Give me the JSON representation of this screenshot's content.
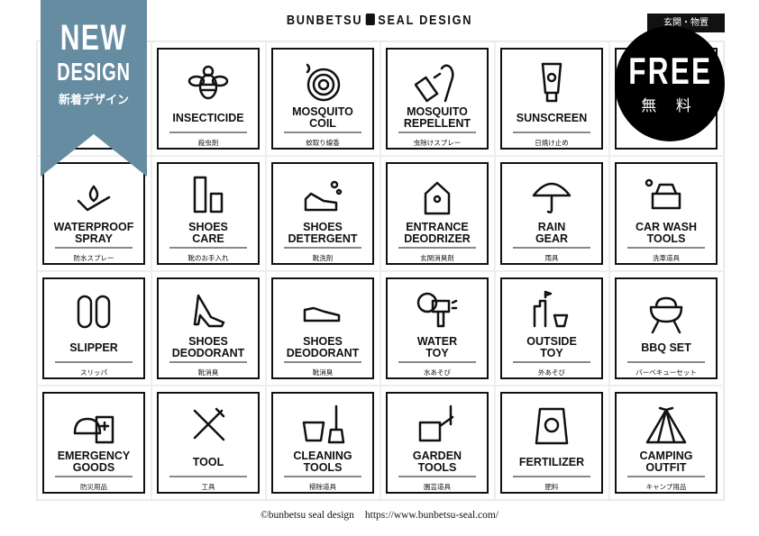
{
  "header": {
    "brand_left": "BUNBETSU",
    "brand_right": "SEAL DESIGN",
    "category_tag": "玄関・物置"
  },
  "ribbon": {
    "line1": "NEW",
    "line2": "DESIGN",
    "line3": "新着デザイン",
    "color": "#668ca2"
  },
  "free_badge": {
    "line1": "FREE",
    "line2": "無 料"
  },
  "labels": [
    {
      "title": "",
      "jp": "",
      "icon": "hidden"
    },
    {
      "title": "INSECTICIDE",
      "jp": "殺虫剤",
      "icon": "bee-icon"
    },
    {
      "title": "MOSQUITO\nCOIL",
      "jp": "蚊取り線香",
      "icon": "mosquito-coil-icon"
    },
    {
      "title": "MOSQUITO\nREPELLENT",
      "jp": "虫除けスプレー",
      "icon": "spray-hand-icon"
    },
    {
      "title": "SUNSCREEN",
      "jp": "日焼け止め",
      "icon": "sunscreen-tube-icon"
    },
    {
      "title": "",
      "jp": "",
      "icon": "hidden"
    },
    {
      "title": "WATERPROOF\nSPRAY",
      "jp": "防水スプレー",
      "icon": "water-drops-icon"
    },
    {
      "title": "SHOES\nCARE",
      "jp": "靴のお手入れ",
      "icon": "shoe-brush-icon"
    },
    {
      "title": "SHOES\nDETERGENT",
      "jp": "靴洗剤",
      "icon": "sneaker-bubbles-icon"
    },
    {
      "title": "ENTRANCE\nDEODRIZER",
      "jp": "玄関消臭剤",
      "icon": "house-icon"
    },
    {
      "title": "RAIN\nGEAR",
      "jp": "雨具",
      "icon": "umbrella-icon"
    },
    {
      "title": "CAR WASH\nTOOLS",
      "jp": "洗車道具",
      "icon": "car-icon"
    },
    {
      "title": "SLIPPER",
      "jp": "スリッパ",
      "icon": "slipper-icon"
    },
    {
      "title": "SHOES\nDEODORANT",
      "jp": "靴消臭",
      "icon": "high-heel-icon"
    },
    {
      "title": "SHOES\nDEODORANT",
      "jp": "靴消臭",
      "icon": "dress-shoe-icon"
    },
    {
      "title": "WATER\nTOY",
      "jp": "水あそび",
      "icon": "water-gun-icon"
    },
    {
      "title": "OUTSIDE\nTOY",
      "jp": "外あそび",
      "icon": "sandcastle-icon"
    },
    {
      "title": "BBQ SET",
      "jp": "バーベキューセット",
      "icon": "grill-icon"
    },
    {
      "title": "EMERGENCY\nGOODS",
      "jp": "防災用品",
      "icon": "helmet-backpack-icon"
    },
    {
      "title": "TOOL",
      "jp": "工具",
      "icon": "hammer-wrench-icon"
    },
    {
      "title": "CLEANING\nTOOLS",
      "jp": "掃除道具",
      "icon": "bucket-broom-icon"
    },
    {
      "title": "GARDEN\nTOOLS",
      "jp": "園芸道具",
      "icon": "watering-can-icon"
    },
    {
      "title": "FERTILIZER",
      "jp": "肥料",
      "icon": "fertilizer-bag-icon"
    },
    {
      "title": "CAMPING\nOUTFIT",
      "jp": "キャンプ用品",
      "icon": "tent-icon"
    }
  ],
  "footer": {
    "copyright": "©bunbetsu seal design",
    "url": "https://www.bunbetsu-seal.com/"
  }
}
